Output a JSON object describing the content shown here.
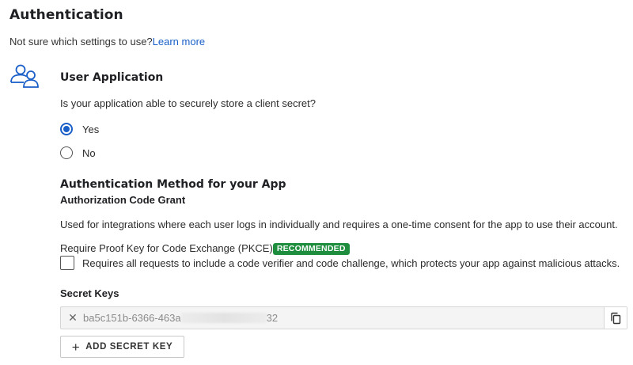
{
  "auth": {
    "title": "Authentication",
    "intro_text": "Not sure which settings to use?",
    "learn_more": "Learn more"
  },
  "user_app": {
    "icon": "users-icon",
    "title": "User Application",
    "question": "Is your application able to securely store a client secret?",
    "options": [
      {
        "label": "Yes",
        "selected": true
      },
      {
        "label": "No",
        "selected": false
      }
    ]
  },
  "method": {
    "title": "Authentication Method for your App",
    "grant": "Authorization Code Grant",
    "description": "Used for integrations where each user logs in individually and requires a one-time consent for the app to use their account.",
    "pkce_label": "Require Proof Key for Code Exchange (PKCE)",
    "pkce_badge": "RECOMMENDED",
    "pkce_checked": false,
    "pkce_description": "Requires all requests to include a code verifier and code challenge, which protects your app against malicious attacks."
  },
  "secret_keys": {
    "title": "Secret Keys",
    "key_prefix": "ba5c151b-6366-463a",
    "key_suffix": "32",
    "add_button": "ADD SECRET KEY"
  },
  "colors": {
    "link": "#1a5fc8",
    "radio_selected": "#1a5fc8",
    "badge_bg": "#1e8e3e"
  }
}
